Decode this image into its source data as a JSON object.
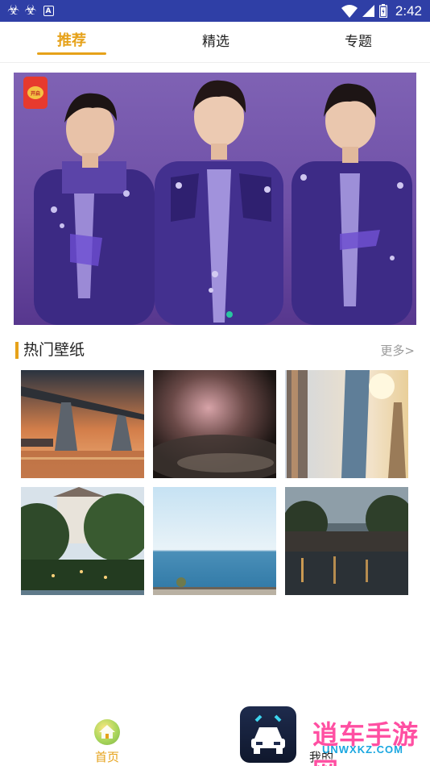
{
  "status_bar": {
    "left_icons": [
      "bug-icon",
      "bug-icon",
      "a-notification-icon"
    ],
    "right_icons": [
      "wifi-icon",
      "signal-icon",
      "battery-icon"
    ],
    "time": "2:42",
    "background": "#2f3fa6"
  },
  "tabs": {
    "items": [
      {
        "label": "推荐",
        "active": true
      },
      {
        "label": "精选",
        "active": false
      },
      {
        "label": "专题",
        "active": false
      }
    ],
    "accent": "#e6a21a"
  },
  "banner": {
    "red_packet_text": "开启",
    "active_slide": 1
  },
  "hot_wallpapers": {
    "title": "热门壁纸",
    "more_label": "更多>",
    "items": [
      {
        "name": "bridge-sunset"
      },
      {
        "name": "blurry-macro"
      },
      {
        "name": "skyscrapers"
      },
      {
        "name": "castle-trees"
      },
      {
        "name": "sea-horizon"
      },
      {
        "name": "river-town"
      }
    ]
  },
  "bottom_nav": {
    "home_label": "首页",
    "mine_label": "我的"
  },
  "watermark": {
    "text": "逍车手游网",
    "url": "UNWXKZ.COM"
  }
}
